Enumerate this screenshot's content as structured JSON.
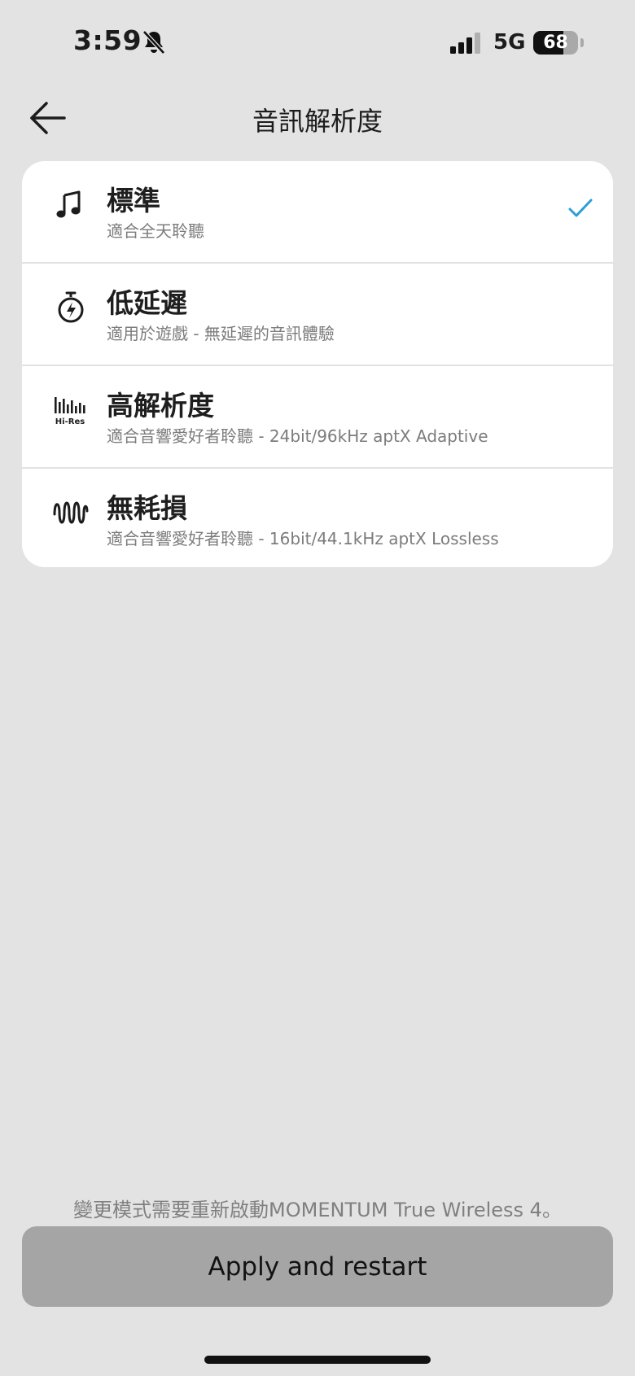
{
  "status_bar": {
    "time": "3:59",
    "network": "5G",
    "battery": "68",
    "battery_level": 0.68
  },
  "header": {
    "title": "音訊解析度"
  },
  "options": [
    {
      "icon": "music-note-icon",
      "title": "標準",
      "subtitle": "適合全天聆聽",
      "selected": true
    },
    {
      "icon": "stopwatch-lightning-icon",
      "title": "低延遲",
      "subtitle": "適用於遊戲 - 無延遲的音訊體驗",
      "selected": false
    },
    {
      "icon": "hi-res-icon",
      "icon_text": "Hi-Res",
      "title": "高解析度",
      "subtitle": "適合音響愛好者聆聽 - 24bit/96kHz aptX Adaptive",
      "selected": false
    },
    {
      "icon": "waveform-icon",
      "title": "無耗損",
      "subtitle": "適合音響愛好者聆聽 - 16bit/44.1kHz aptX Lossless",
      "selected": false
    }
  ],
  "footer": {
    "notice": "變更模式需要重新啟動MOMENTUM True Wireless 4。",
    "apply_label": "Apply and restart"
  },
  "colors": {
    "accent": "#2a9fd8",
    "background": "#e3e3e3",
    "button": "#a5a5a5"
  }
}
